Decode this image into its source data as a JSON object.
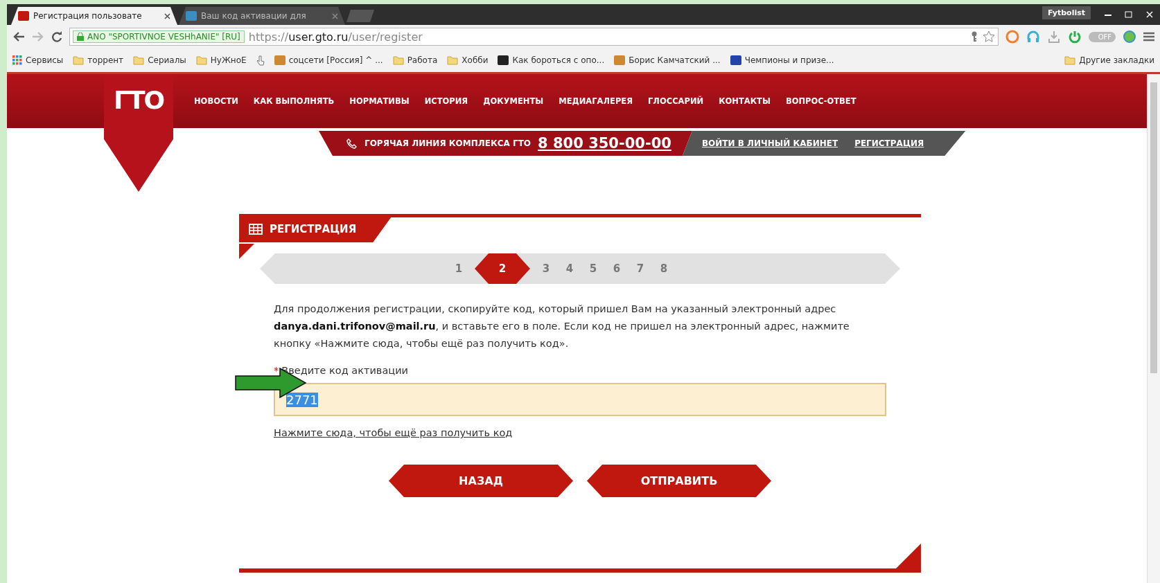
{
  "browser": {
    "tabs": [
      {
        "title": "Регистрация пользовате",
        "selected": true
      },
      {
        "title": "Ваш код активации для",
        "selected": false
      }
    ],
    "profile": "Fytbolist",
    "address": {
      "identity": "ANO \"SPORTIVNOE VESHhANIE\" [RU]",
      "scheme": "https://",
      "host": "user.gto.ru",
      "path": "/user/register"
    },
    "extension_toggle": "OFF",
    "bookmarks": [
      {
        "kind": "apps",
        "label": "Сервисы"
      },
      {
        "kind": "folder",
        "label": "торрент"
      },
      {
        "kind": "folder",
        "label": "Сериалы"
      },
      {
        "kind": "folder",
        "label": "НуЖноЕ"
      },
      {
        "kind": "page"
      },
      {
        "kind": "site",
        "label": "соцсети [Россия] ^ ..."
      },
      {
        "kind": "folder",
        "label": "Работа"
      },
      {
        "kind": "folder",
        "label": "Хобби"
      },
      {
        "kind": "site",
        "label": "Как бороться с опо..."
      },
      {
        "kind": "site",
        "label": "Борис Камчатский ..."
      },
      {
        "kind": "site",
        "label": "Чемпионы и призе..."
      }
    ],
    "other_bookmarks": "Другие закладки"
  },
  "site": {
    "logo": "ГТО",
    "nav": [
      "НОВОСТИ",
      "КАК ВЫПОЛНЯТЬ",
      "НОРМАТИВЫ",
      "ИСТОРИЯ",
      "ДОКУМЕНТЫ",
      "МЕДИАГАЛЕРЕЯ",
      "ГЛОССАРИЙ",
      "КОНТАКТЫ",
      "ВОПРОС-ОТВЕТ"
    ],
    "hotline": {
      "label": "ГОРЯЧАЯ ЛИНИЯ КОМПЛЕКСА ГТО",
      "phone": "8 800 350-00-00"
    },
    "account_links": [
      "ВОЙТИ В ЛИЧНЫЙ КАБИНЕТ",
      "РЕГИСТРАЦИЯ"
    ]
  },
  "form": {
    "title": "РЕГИСТРАЦИЯ",
    "steps": [
      {
        "label": "1",
        "selected": false
      },
      {
        "label": "2",
        "selected": true
      },
      {
        "label": "3",
        "selected": false
      },
      {
        "label": "4",
        "selected": false
      },
      {
        "label": "5",
        "selected": false
      },
      {
        "label": "6",
        "selected": false
      },
      {
        "label": "7",
        "selected": false
      },
      {
        "label": "8",
        "selected": false
      }
    ],
    "instructions": "Для продолжения регистрации, скопируйте код, который пришел Вам на указанный электронный адрес **danya.dani.trifonov@mail.ru**, и вставьте его в поле. Если код не пришел на электронный адрес, нажмите кнопку «Нажмите сюда, чтобы ещё раз получить код».",
    "code_field": {
      "label": "Введите код активации",
      "required_mark": "*",
      "value": "2771"
    },
    "resend_link": "Нажмите сюда, чтобы ещё раз получить код",
    "buttons": [
      "НАЗАД",
      "ОТПРАВИТЬ"
    ]
  }
}
